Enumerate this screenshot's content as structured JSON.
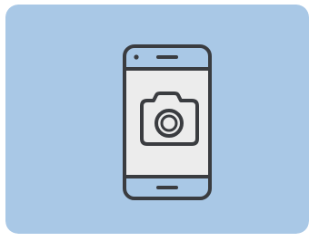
{
  "illustration": {
    "subject": "smartphone-with-camera-icon",
    "colors": {
      "page_background": "#ffffff",
      "card_background": "#a9c8e6",
      "outline": "#3a3c40",
      "phone_bar": "#a9c8e6",
      "screen": "#ececec"
    }
  }
}
